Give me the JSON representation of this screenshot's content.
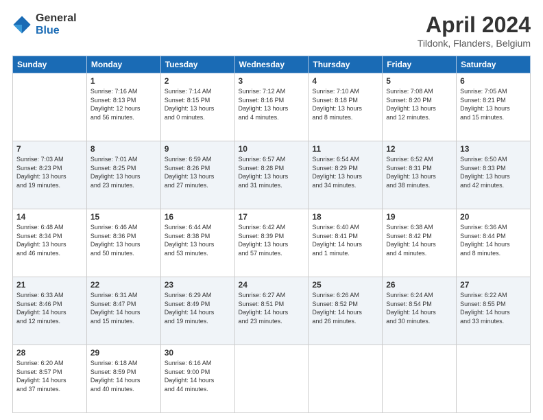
{
  "header": {
    "logo_general": "General",
    "logo_blue": "Blue",
    "month_title": "April 2024",
    "location": "Tildonk, Flanders, Belgium"
  },
  "calendar": {
    "days_of_week": [
      "Sunday",
      "Monday",
      "Tuesday",
      "Wednesday",
      "Thursday",
      "Friday",
      "Saturday"
    ],
    "weeks": [
      [
        {
          "day": "",
          "info": ""
        },
        {
          "day": "1",
          "info": "Sunrise: 7:16 AM\nSunset: 8:13 PM\nDaylight: 12 hours\nand 56 minutes."
        },
        {
          "day": "2",
          "info": "Sunrise: 7:14 AM\nSunset: 8:15 PM\nDaylight: 13 hours\nand 0 minutes."
        },
        {
          "day": "3",
          "info": "Sunrise: 7:12 AM\nSunset: 8:16 PM\nDaylight: 13 hours\nand 4 minutes."
        },
        {
          "day": "4",
          "info": "Sunrise: 7:10 AM\nSunset: 8:18 PM\nDaylight: 13 hours\nand 8 minutes."
        },
        {
          "day": "5",
          "info": "Sunrise: 7:08 AM\nSunset: 8:20 PM\nDaylight: 13 hours\nand 12 minutes."
        },
        {
          "day": "6",
          "info": "Sunrise: 7:05 AM\nSunset: 8:21 PM\nDaylight: 13 hours\nand 15 minutes."
        }
      ],
      [
        {
          "day": "7",
          "info": "Sunrise: 7:03 AM\nSunset: 8:23 PM\nDaylight: 13 hours\nand 19 minutes."
        },
        {
          "day": "8",
          "info": "Sunrise: 7:01 AM\nSunset: 8:25 PM\nDaylight: 13 hours\nand 23 minutes."
        },
        {
          "day": "9",
          "info": "Sunrise: 6:59 AM\nSunset: 8:26 PM\nDaylight: 13 hours\nand 27 minutes."
        },
        {
          "day": "10",
          "info": "Sunrise: 6:57 AM\nSunset: 8:28 PM\nDaylight: 13 hours\nand 31 minutes."
        },
        {
          "day": "11",
          "info": "Sunrise: 6:54 AM\nSunset: 8:29 PM\nDaylight: 13 hours\nand 34 minutes."
        },
        {
          "day": "12",
          "info": "Sunrise: 6:52 AM\nSunset: 8:31 PM\nDaylight: 13 hours\nand 38 minutes."
        },
        {
          "day": "13",
          "info": "Sunrise: 6:50 AM\nSunset: 8:33 PM\nDaylight: 13 hours\nand 42 minutes."
        }
      ],
      [
        {
          "day": "14",
          "info": "Sunrise: 6:48 AM\nSunset: 8:34 PM\nDaylight: 13 hours\nand 46 minutes."
        },
        {
          "day": "15",
          "info": "Sunrise: 6:46 AM\nSunset: 8:36 PM\nDaylight: 13 hours\nand 50 minutes."
        },
        {
          "day": "16",
          "info": "Sunrise: 6:44 AM\nSunset: 8:38 PM\nDaylight: 13 hours\nand 53 minutes."
        },
        {
          "day": "17",
          "info": "Sunrise: 6:42 AM\nSunset: 8:39 PM\nDaylight: 13 hours\nand 57 minutes."
        },
        {
          "day": "18",
          "info": "Sunrise: 6:40 AM\nSunset: 8:41 PM\nDaylight: 14 hours\nand 1 minute."
        },
        {
          "day": "19",
          "info": "Sunrise: 6:38 AM\nSunset: 8:42 PM\nDaylight: 14 hours\nand 4 minutes."
        },
        {
          "day": "20",
          "info": "Sunrise: 6:36 AM\nSunset: 8:44 PM\nDaylight: 14 hours\nand 8 minutes."
        }
      ],
      [
        {
          "day": "21",
          "info": "Sunrise: 6:33 AM\nSunset: 8:46 PM\nDaylight: 14 hours\nand 12 minutes."
        },
        {
          "day": "22",
          "info": "Sunrise: 6:31 AM\nSunset: 8:47 PM\nDaylight: 14 hours\nand 15 minutes."
        },
        {
          "day": "23",
          "info": "Sunrise: 6:29 AM\nSunset: 8:49 PM\nDaylight: 14 hours\nand 19 minutes."
        },
        {
          "day": "24",
          "info": "Sunrise: 6:27 AM\nSunset: 8:51 PM\nDaylight: 14 hours\nand 23 minutes."
        },
        {
          "day": "25",
          "info": "Sunrise: 6:26 AM\nSunset: 8:52 PM\nDaylight: 14 hours\nand 26 minutes."
        },
        {
          "day": "26",
          "info": "Sunrise: 6:24 AM\nSunset: 8:54 PM\nDaylight: 14 hours\nand 30 minutes."
        },
        {
          "day": "27",
          "info": "Sunrise: 6:22 AM\nSunset: 8:55 PM\nDaylight: 14 hours\nand 33 minutes."
        }
      ],
      [
        {
          "day": "28",
          "info": "Sunrise: 6:20 AM\nSunset: 8:57 PM\nDaylight: 14 hours\nand 37 minutes."
        },
        {
          "day": "29",
          "info": "Sunrise: 6:18 AM\nSunset: 8:59 PM\nDaylight: 14 hours\nand 40 minutes."
        },
        {
          "day": "30",
          "info": "Sunrise: 6:16 AM\nSunset: 9:00 PM\nDaylight: 14 hours\nand 44 minutes."
        },
        {
          "day": "",
          "info": ""
        },
        {
          "day": "",
          "info": ""
        },
        {
          "day": "",
          "info": ""
        },
        {
          "day": "",
          "info": ""
        }
      ]
    ]
  }
}
